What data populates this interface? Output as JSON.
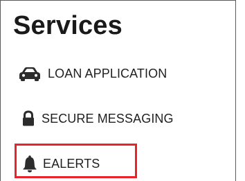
{
  "services": {
    "title": "Services",
    "items": [
      {
        "label": "LOAN APPLICATION",
        "icon": "car-icon"
      },
      {
        "label": "SECURE MESSAGING",
        "icon": "lock-icon"
      },
      {
        "label": "EALERTS",
        "icon": "bell-icon"
      }
    ]
  },
  "colors": {
    "text": "#1f1f1f",
    "highlight": "#e8232a"
  }
}
